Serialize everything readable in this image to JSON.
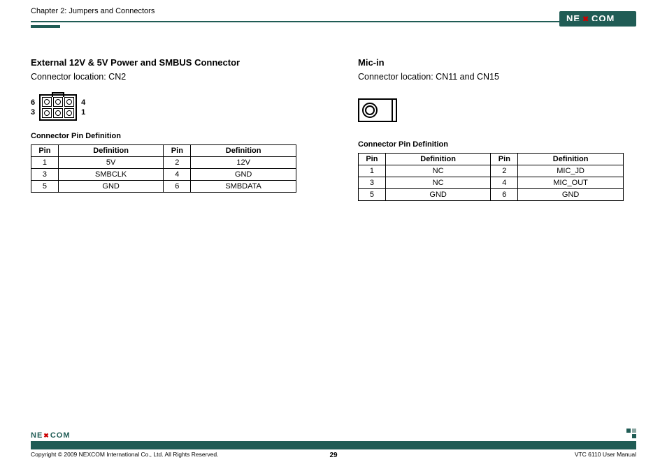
{
  "header": {
    "chapter": "Chapter 2: Jumpers and Connectors",
    "brand": "NEXCOM"
  },
  "left": {
    "title": "External 12V & 5V Power and SMBUS Connector",
    "location": "Connector location: CN2",
    "diagram_labels": {
      "top_left": "6",
      "top_right": "4",
      "bot_left": "3",
      "bot_right": "1"
    },
    "table_title": "Connector Pin Definition",
    "table_headers": {
      "pin": "Pin",
      "def": "Definition"
    },
    "rows": [
      {
        "p1": "1",
        "d1": "5V",
        "p2": "2",
        "d2": "12V"
      },
      {
        "p1": "3",
        "d1": "SMBCLK",
        "p2": "4",
        "d2": "GND"
      },
      {
        "p1": "5",
        "d1": "GND",
        "p2": "6",
        "d2": "SMBDATA"
      }
    ]
  },
  "right": {
    "title": "Mic-in",
    "location": "Connector location: CN11 and CN15",
    "table_title": "Connector Pin Definition",
    "table_headers": {
      "pin": "Pin",
      "def": "Definition"
    },
    "rows": [
      {
        "p1": "1",
        "d1": "NC",
        "p2": "2",
        "d2": "MIC_JD"
      },
      {
        "p1": "3",
        "d1": "NC",
        "p2": "4",
        "d2": "MIC_OUT"
      },
      {
        "p1": "5",
        "d1": "GND",
        "p2": "6",
        "d2": "GND"
      }
    ]
  },
  "footer": {
    "copyright": "Copyright © 2009 NEXCOM International Co., Ltd. All Rights Reserved.",
    "page": "29",
    "manual": "VTC 6110 User Manual",
    "brand": "NEXCOM"
  }
}
